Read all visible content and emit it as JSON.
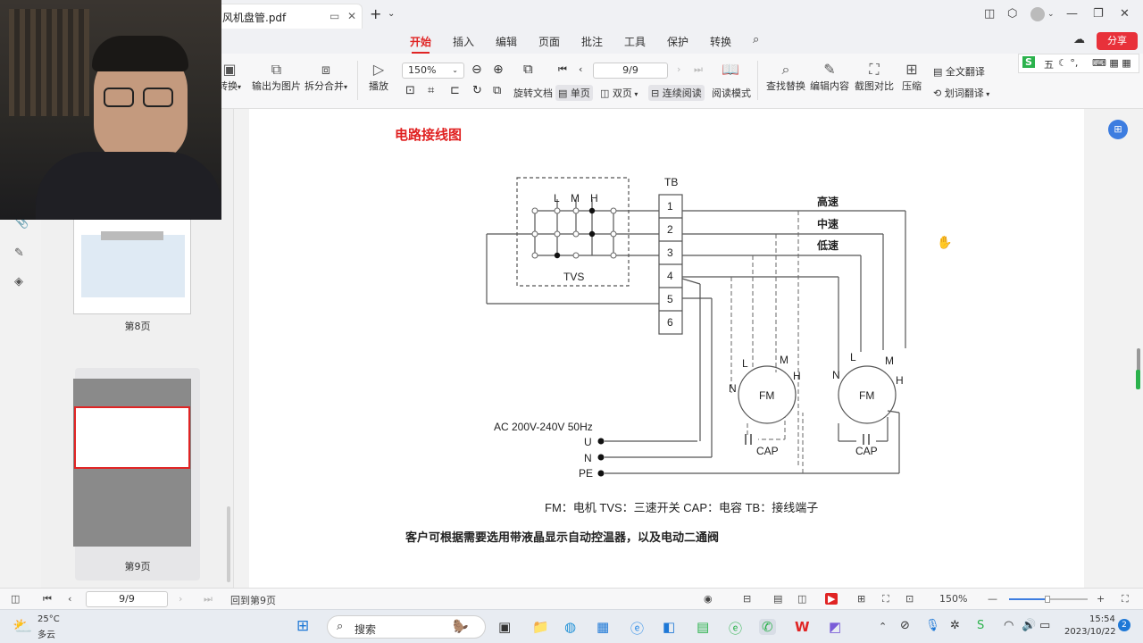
{
  "tab": {
    "title": "风机盘管.pdf"
  },
  "menu": {
    "items": [
      "开始",
      "插入",
      "编辑",
      "页面",
      "批注",
      "工具",
      "保护",
      "转换"
    ],
    "share_label": "分享",
    "ime_label": "五"
  },
  "toolbar": {
    "convert": "转换",
    "export_image": "输出为图片",
    "split_merge": "拆分合并",
    "play": "播放",
    "zoom_value": "150%",
    "page_value": "9/9",
    "rotate": "旋转文档",
    "single_page": "单页",
    "double_page": "双页",
    "continuous": "连续阅读",
    "read_mode": "阅读模式",
    "find_replace": "查找替换",
    "edit_content": "编辑内容",
    "screenshot_compare": "截图对比",
    "compress": "压缩",
    "full_translate": "全文翻译",
    "word_translate": "划词翻译"
  },
  "thumbnails": [
    {
      "label": "第8页"
    },
    {
      "label": "第9页"
    }
  ],
  "document": {
    "heading": "电路接线图",
    "tb_label": "TB",
    "tb_terminals": [
      "1",
      "2",
      "3",
      "4",
      "5",
      "6"
    ],
    "switch_labels": [
      "L",
      "M",
      "H"
    ],
    "tvs_label": "TVS",
    "speed_high": "高速",
    "speed_mid": "中速",
    "speed_low": "低速",
    "power_label": "AC 200V-240V 50Hz",
    "power_terminals": [
      "U",
      "N",
      "PE"
    ],
    "motor_label": "FM",
    "motor_pins": [
      "L",
      "M",
      "H",
      "N"
    ],
    "cap_label": "CAP",
    "legend": "FM：电机    TVS：三速开关    CAP：电容    TB：接线端子",
    "note": "客户可根据需要选用带液晶显示自动控温器，以及电动二通阀"
  },
  "status": {
    "page_value": "9/9",
    "back_to_page": "回到第9页",
    "zoom": "150%"
  },
  "taskbar": {
    "weather_temp": "25°C",
    "weather_desc": "多云",
    "search_label": "搜索",
    "time": "15:54",
    "date": "2023/10/22",
    "notif_count": "2"
  }
}
